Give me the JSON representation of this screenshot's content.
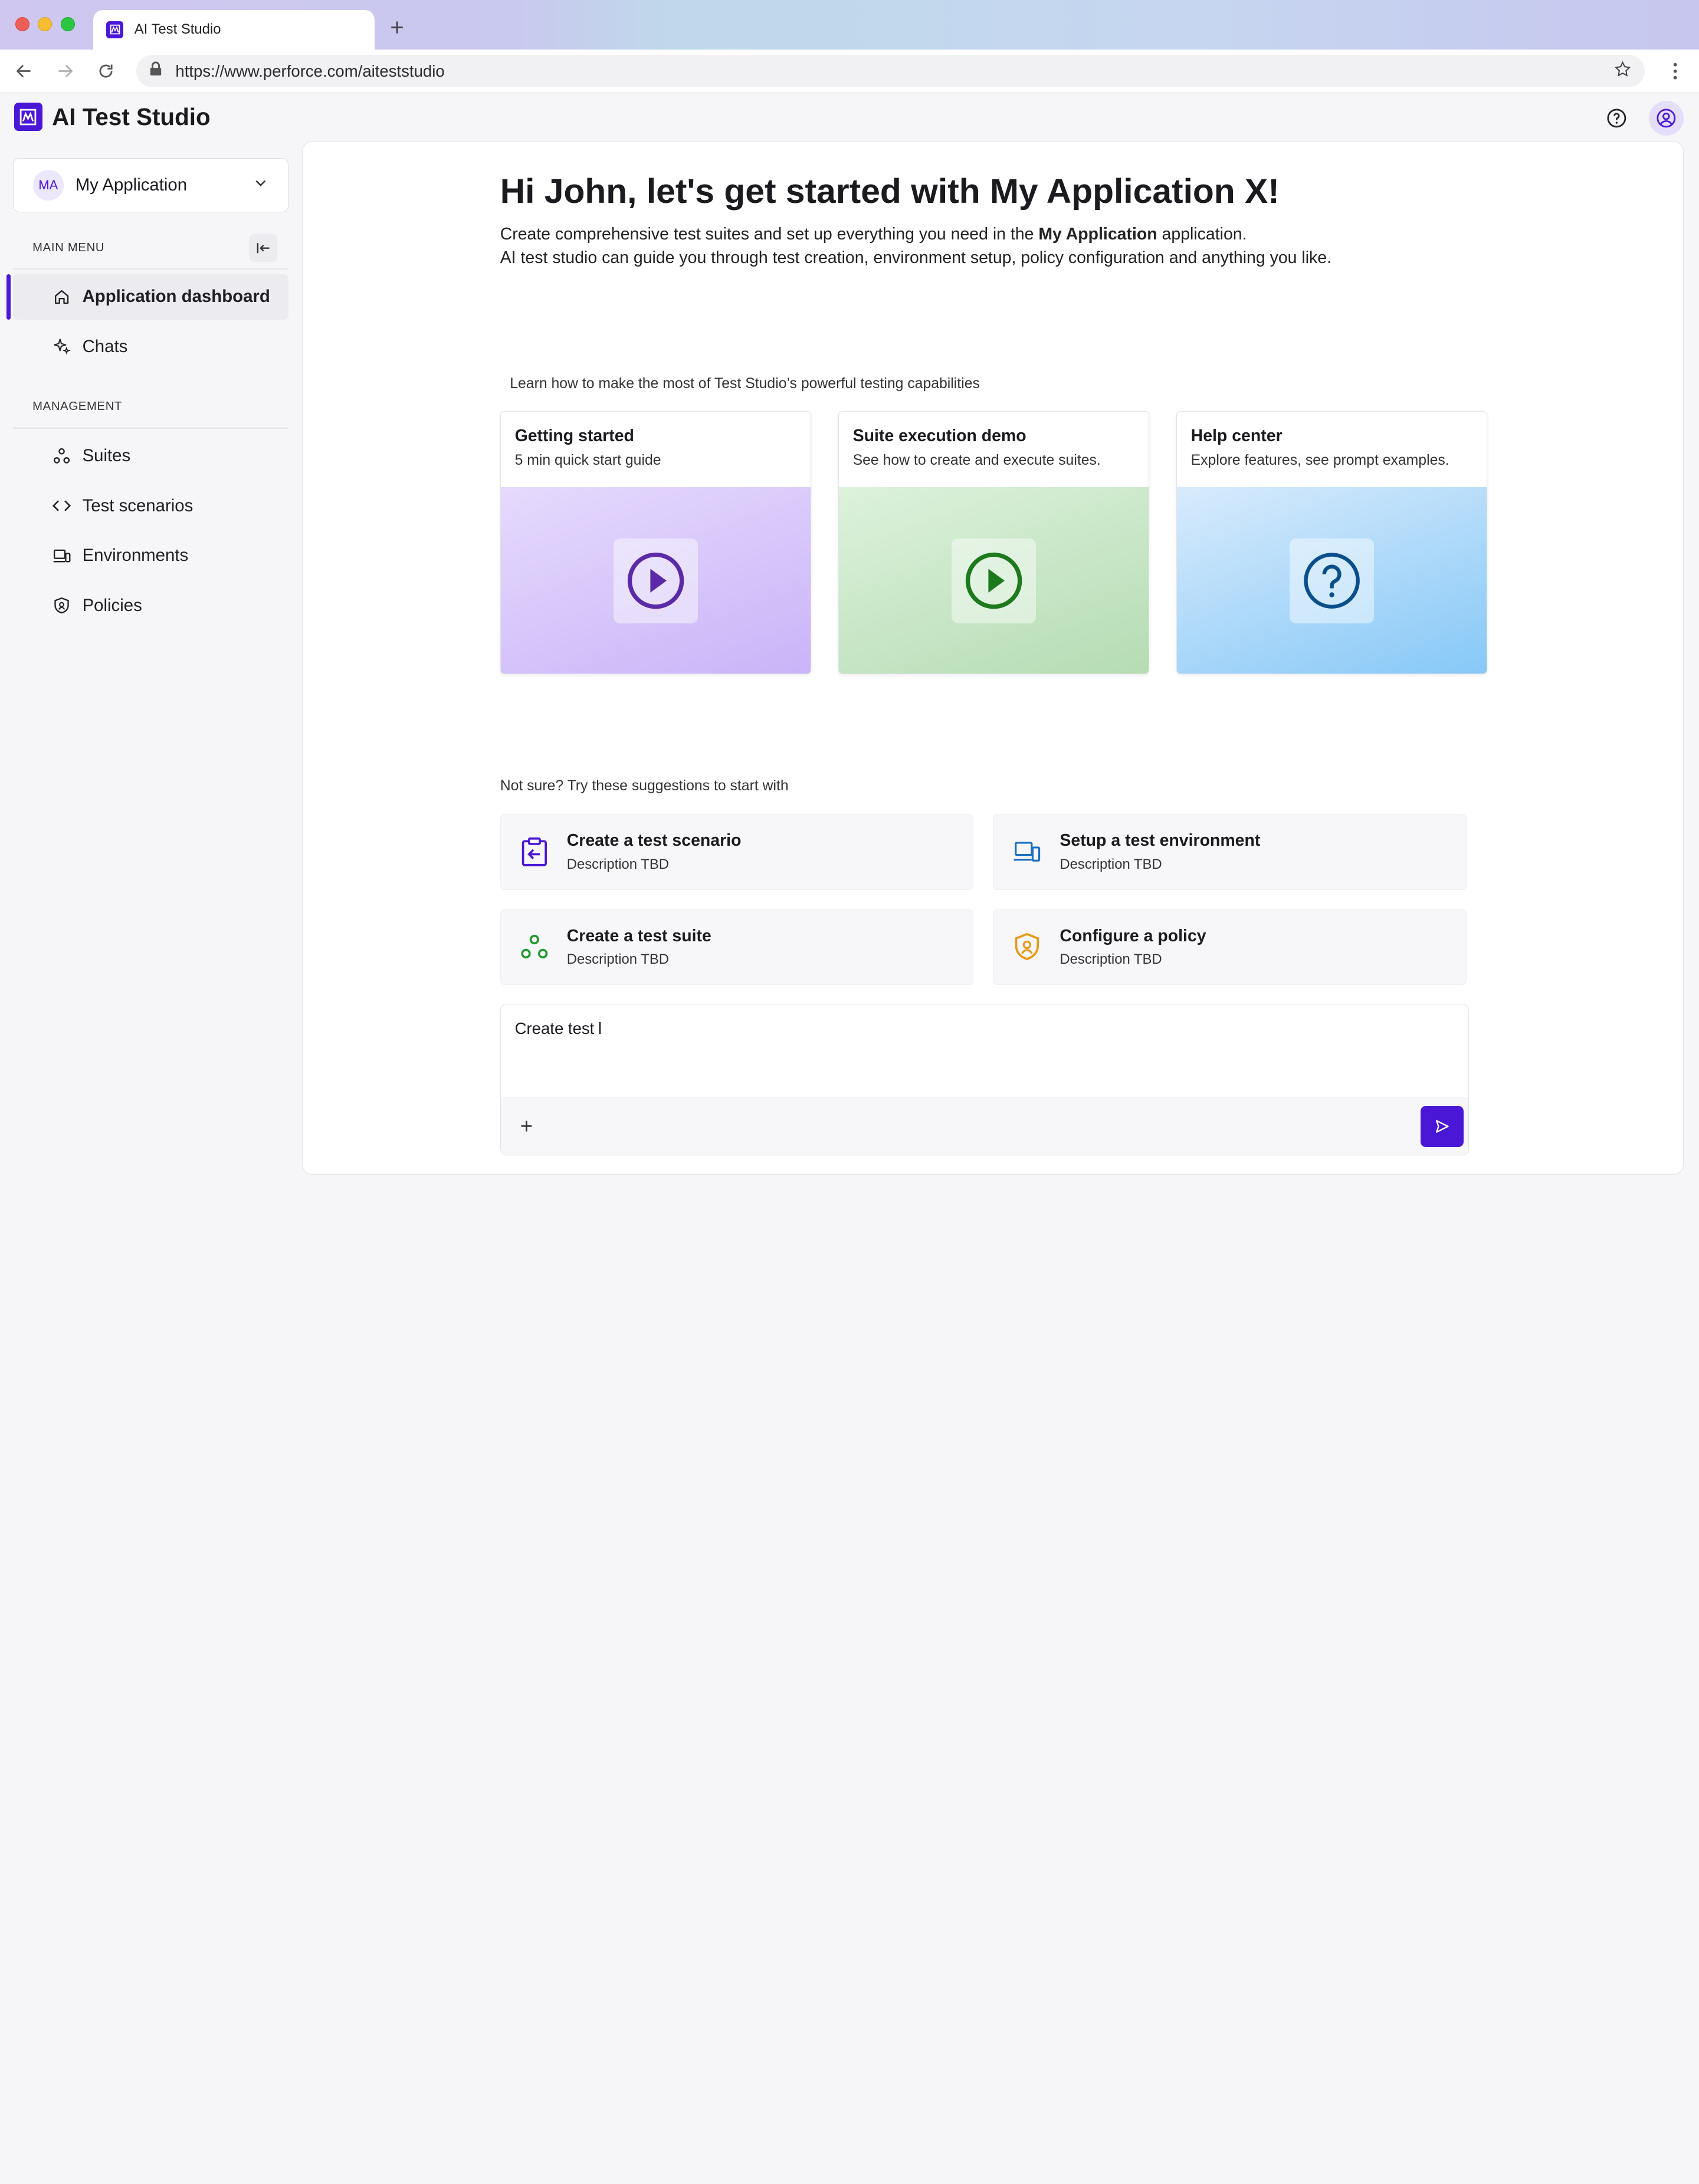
{
  "browser": {
    "tab_title": "AI Test Studio",
    "new_tab": "+",
    "url": "https://www.perforce.com/aiteststudio"
  },
  "app": {
    "title": "AI Test Studio",
    "accent": "#4b17d6"
  },
  "sidebar": {
    "app_select": {
      "initials": "MA",
      "label": "My Application"
    },
    "main_menu_heading": "MAIN MENU",
    "main_items": [
      {
        "label": "Application dashboard",
        "icon": "home-icon",
        "active": true
      },
      {
        "label": "Chats",
        "icon": "sparkle-icon",
        "active": false
      }
    ],
    "management_heading": "MANAGEMENT",
    "management_items": [
      {
        "label": "Suites",
        "icon": "suites-icon"
      },
      {
        "label": "Test scenarios",
        "icon": "code-icon"
      },
      {
        "label": "Environments",
        "icon": "devices-icon"
      },
      {
        "label": "Policies",
        "icon": "shield-icon"
      }
    ]
  },
  "main": {
    "greeting": "Hi John, let's get started with My Application X!",
    "intro_line1_pre": "Create comprehensive test suites and set up everything you need in the ",
    "intro_line1_bold": "My Application",
    "intro_line1_post": " application.",
    "intro_line2": "AI test studio can guide you through test creation, environment setup, policy configuration and anything you like.",
    "learn_caption": "Learn how to make the most of Test Studio’s powerful testing capabilities",
    "cards": [
      {
        "title": "Getting started",
        "subtitle": "5 min quick start guide",
        "icon": "play-icon",
        "color": "#5b2aa8"
      },
      {
        "title": "Suite execution demo",
        "subtitle": "See how to create and execute suites.",
        "icon": "play-icon",
        "color": "#1c7a1c"
      },
      {
        "title": "Help center",
        "subtitle": "Explore features, see prompt examples.",
        "icon": "question-icon",
        "color": "#0a4f8c"
      }
    ],
    "suggestions_caption": "Not sure? Try these suggestions to start with",
    "suggestions": [
      {
        "title": "Create a test scenario",
        "desc": "Description TBD",
        "icon": "clipboard-icon",
        "color": "#4b17d6"
      },
      {
        "title": "Setup a test environment",
        "desc": "Description TBD",
        "icon": "devices-icon",
        "color": "#1a6ec2"
      },
      {
        "title": "Create a test suite",
        "desc": "Description TBD",
        "icon": "suites-icon",
        "color": "#1e9a2a"
      },
      {
        "title": "Configure a policy",
        "desc": "Description TBD",
        "icon": "shield-icon",
        "color": "#e89a1c"
      }
    ],
    "composer": {
      "value": "Create test",
      "plus": "+"
    }
  }
}
